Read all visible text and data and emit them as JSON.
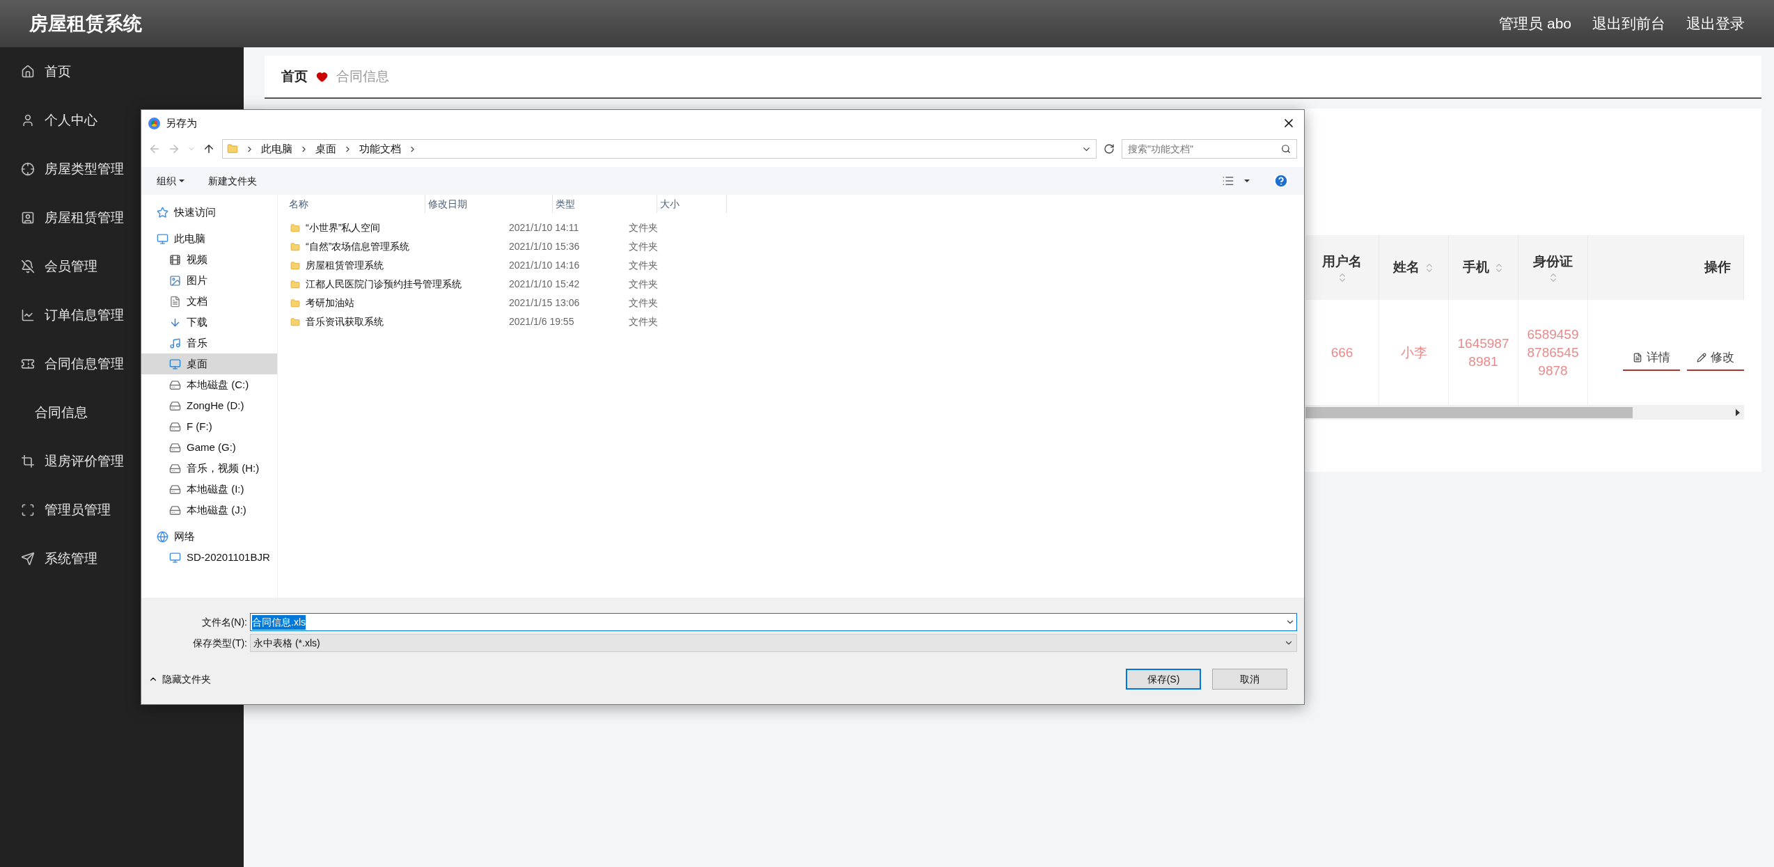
{
  "header": {
    "title": "房屋租赁系统",
    "links": [
      "管理员 abo",
      "退出到前台",
      "退出登录"
    ]
  },
  "sidebar": {
    "items": [
      {
        "label": "首页"
      },
      {
        "label": "个人中心"
      },
      {
        "label": "房屋类型管理"
      },
      {
        "label": "房屋租赁管理"
      },
      {
        "label": "会员管理"
      },
      {
        "label": "订单信息管理"
      },
      {
        "label": "合同信息管理",
        "children": [
          {
            "label": "合同信息"
          }
        ]
      },
      {
        "label": "退房评价管理"
      },
      {
        "label": "管理员管理"
      },
      {
        "label": "系统管理"
      }
    ]
  },
  "breadcrumb": {
    "home": "首页",
    "current": "合同信息"
  },
  "table": {
    "columns": [
      {
        "label": "用户名",
        "sortable": true
      },
      {
        "label": "姓名",
        "sortable": true
      },
      {
        "label": "手机",
        "sortable": true
      },
      {
        "label": "身份证",
        "sortable": true
      },
      {
        "label": "操作",
        "sortable": false
      }
    ],
    "rows": [
      {
        "cells": [
          "666",
          "小李",
          "16459878981",
          "658945987865459878"
        ],
        "actions": [
          "详情",
          "修改"
        ]
      }
    ]
  },
  "dialog": {
    "title": "另存为",
    "path": [
      "此电脑",
      "桌面",
      "功能文档"
    ],
    "search_placeholder": "搜索\"功能文档\"",
    "toolbar": [
      "组织",
      "新建文件夹"
    ],
    "nav": [
      {
        "label": "快速访问",
        "selected": false
      },
      {
        "label": "此电脑",
        "selected": false,
        "children": [
          {
            "label": "视频",
            "selected": false
          },
          {
            "label": "图片",
            "selected": false
          },
          {
            "label": "文档",
            "selected": false
          },
          {
            "label": "下载",
            "selected": false
          },
          {
            "label": "音乐",
            "selected": false
          },
          {
            "label": "桌面",
            "selected": true
          },
          {
            "label": "本地磁盘 (C:)",
            "selected": false
          },
          {
            "label": "ZongHe (D:)",
            "selected": false
          },
          {
            "label": "F (F:)",
            "selected": false
          },
          {
            "label": "Game (G:)",
            "selected": false
          },
          {
            "label": "音乐，视频 (H:)",
            "selected": false
          },
          {
            "label": "本地磁盘 (I:)",
            "selected": false
          },
          {
            "label": "本地磁盘 (J:)",
            "selected": false
          }
        ]
      },
      {
        "label": "网络",
        "selected": false,
        "children": [
          {
            "label": "SD-20201101BJR",
            "selected": false
          }
        ]
      }
    ],
    "columns": [
      "名称",
      "修改日期",
      "类型",
      "大小"
    ],
    "files": [
      {
        "name": "“小世界”私人空间",
        "date": "2021/1/10 14:11",
        "type": "文件夹"
      },
      {
        "name": "“自然”农场信息管理系统",
        "date": "2021/1/10 15:36",
        "type": "文件夹"
      },
      {
        "name": "房屋租赁管理系统",
        "date": "2021/1/10 14:16",
        "type": "文件夹"
      },
      {
        "name": "江都人民医院门诊预约挂号管理系统",
        "date": "2021/1/10 15:42",
        "type": "文件夹"
      },
      {
        "name": "考研加油站",
        "date": "2021/1/15 13:06",
        "type": "文件夹"
      },
      {
        "name": "音乐资讯获取系统",
        "date": "2021/1/6 19:55",
        "type": "文件夹"
      }
    ],
    "filename_label": "文件名(N):",
    "filename": "合同信息.xls",
    "filetype_label": "保存类型(T):",
    "filetype": "永中表格 (*.xls)",
    "hide_folders": "隐藏文件夹",
    "buttons": [
      "保存(S)",
      "取消"
    ]
  }
}
